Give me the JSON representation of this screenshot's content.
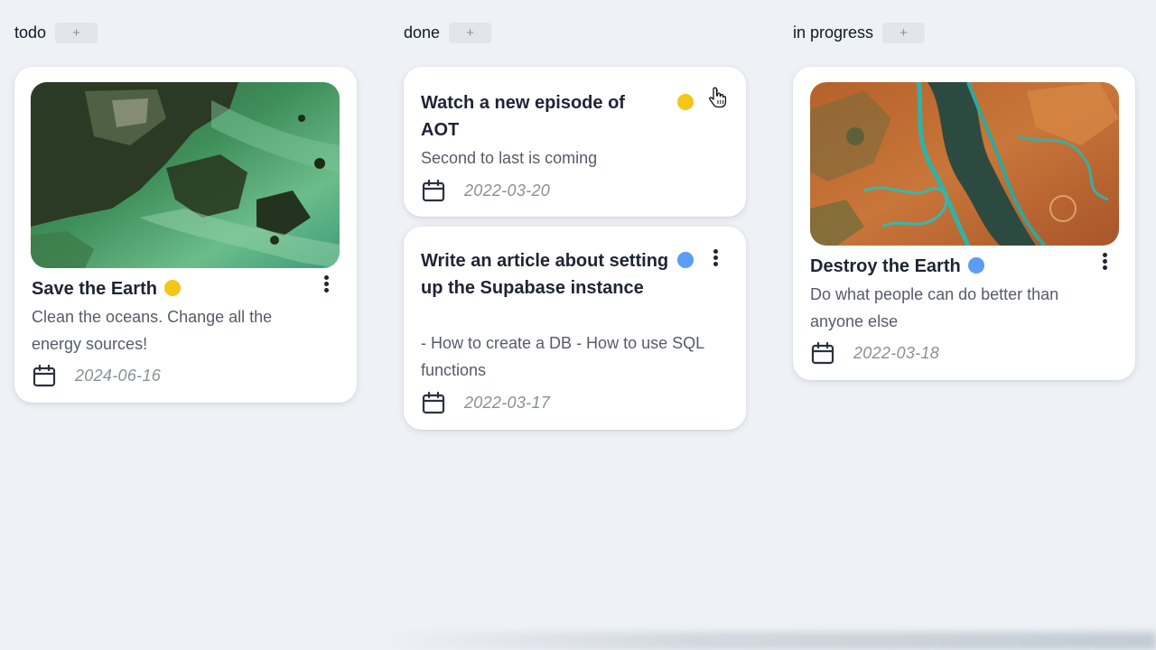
{
  "columns": [
    {
      "title": "todo",
      "add_label": "+",
      "cards": [
        {
          "title": "Save the Earth",
          "status_color": "#f5c518",
          "description": "Clean the oceans. Change all the energy sources!",
          "date": "2024-06-16",
          "image": "coastal-satellite-image"
        }
      ]
    },
    {
      "title": "done",
      "add_label": "+",
      "cards": [
        {
          "title": "Watch a new episode of AOT",
          "status_color": "#f5c518",
          "description": "Second to last is coming",
          "date": "2022-03-20"
        },
        {
          "title": "Write an article about setting up the Supabase instance",
          "status_color": "#5b9cf5",
          "description": "- How to create a DB - How to use SQL functions",
          "date": "2022-03-17"
        }
      ]
    },
    {
      "title": "in progress",
      "add_label": "+",
      "cards": [
        {
          "title": "Destroy the Earth",
          "status_color": "#5b9cf5",
          "description": "Do what people can do better than anyone else",
          "date": "2022-03-18",
          "image": "river-delta-satellite-image"
        }
      ]
    }
  ],
  "icons": {
    "calendar": "calendar-icon",
    "menu": "more-vertical-icon",
    "cursor": "hand-pointer-cursor-icon"
  },
  "colors": {
    "background": "#eef1f5",
    "card": "#ffffff",
    "text": "#1e2433",
    "muted": "#8a8f98"
  }
}
